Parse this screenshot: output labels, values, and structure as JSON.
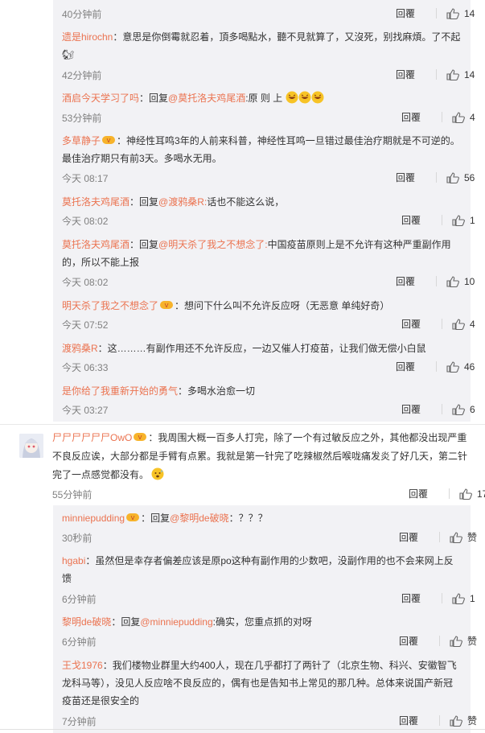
{
  "reply_label": "回覆",
  "block1": [
    {
      "user": "",
      "text": "",
      "time": "40分钟前",
      "likes": "14"
    },
    {
      "user": "遗是hirochn",
      "text": "：意思是你倒霉就忍着，頂多喝點水，聽不見就算了，又沒死，别找麻煩。了不起",
      "text2": "🐿",
      "time": "42分钟前",
      "likes": "14"
    },
    {
      "user": "酒启今天学习了吗",
      "pre": "：回复",
      "mention": "@莫托洛夫鸡尾酒",
      "text": ":原 则 上",
      "time": "53分钟前",
      "likes": "4"
    },
    {
      "user": "多草静子",
      "text": "：神经性耳鸣3年的人前来科普，神经性耳鸣一旦错过最佳治疗期就是不可逆的。",
      "text2": "最佳治疗期只有前3天。多喝水无用。",
      "time": "今天 08:17",
      "likes": "56"
    },
    {
      "user": "莫托洛夫鸡尾酒",
      "pre": "：回复",
      "mention": "@渡鸦桑R:",
      "text": "话也不能这么说，",
      "time": "今天 08:02",
      "likes": "1"
    },
    {
      "user": "莫托洛夫鸡尾酒",
      "pre": "：回复",
      "mention": "@明天杀了我之不想念了:",
      "text": "中国疫苗原则上是不允许有这种严重副作用",
      "text2": "的，所以不能上报",
      "time": "今天 08:02",
      "likes": "10"
    },
    {
      "user": "明天杀了我之不想念了",
      "text": "：想问下什么叫不允许反应呀（无恶意 单纯好奇）",
      "time": "今天 07:52",
      "likes": "4"
    },
    {
      "user": "渡鸦桑R",
      "text": "：这………有副作用还不允许反应，一边又催人打疫苗，让我们做无偿小白鼠",
      "time": "今天 06:33",
      "likes": "46"
    },
    {
      "user": "是你给了我重新开始的勇气",
      "text": "：多喝水治愈一切",
      "time": "今天 03:27",
      "likes": "6"
    }
  ],
  "top_comment": {
    "user": "尸尸尸尸尸尸OwO",
    "line1": "：我周围大概一百多人打完，除了一个有过敏反应之外，其他都没出现严重",
    "line2": "不良反应诶，大部分都是手臂有点累。我就是第一针完了吃辣椒然后喉咙痛发炎了好几天，第二针",
    "line3": "完了一点感觉都没有。",
    "time": "55分钟前",
    "likes": "17"
  },
  "block2": [
    {
      "user": "minniepudding",
      "pre": "：回复",
      "mention": "@黎明de破晓",
      "text": "：？？？",
      "time": "30秒前",
      "likes": "赞"
    },
    {
      "user": "hgabi",
      "text": "：虽然但是幸存者偏差应该是原po这种有副作用的少数吧，没副作用的也不会来网上反",
      "text2": "馈",
      "time": "6分钟前",
      "likes": "1"
    },
    {
      "user": "黎明de破晓",
      "pre": "：回复",
      "mention": "@minniepudding",
      "text": ":确实，您重点抓的对呀",
      "time": "6分钟前",
      "likes": "赞"
    },
    {
      "user": "王戈1976",
      "text": "：我们楼物业群里大约400人，现在几乎都打了两针了（北京生物、科兴、安徽智飞",
      "text2": "龙科马等），没见人反应啥不良反应的，偶有也是告知书上常见的那几种。总体来说国产新冠",
      "text3": "疫苗还是很安全的",
      "time": "7分钟前",
      "likes": "赞"
    }
  ]
}
